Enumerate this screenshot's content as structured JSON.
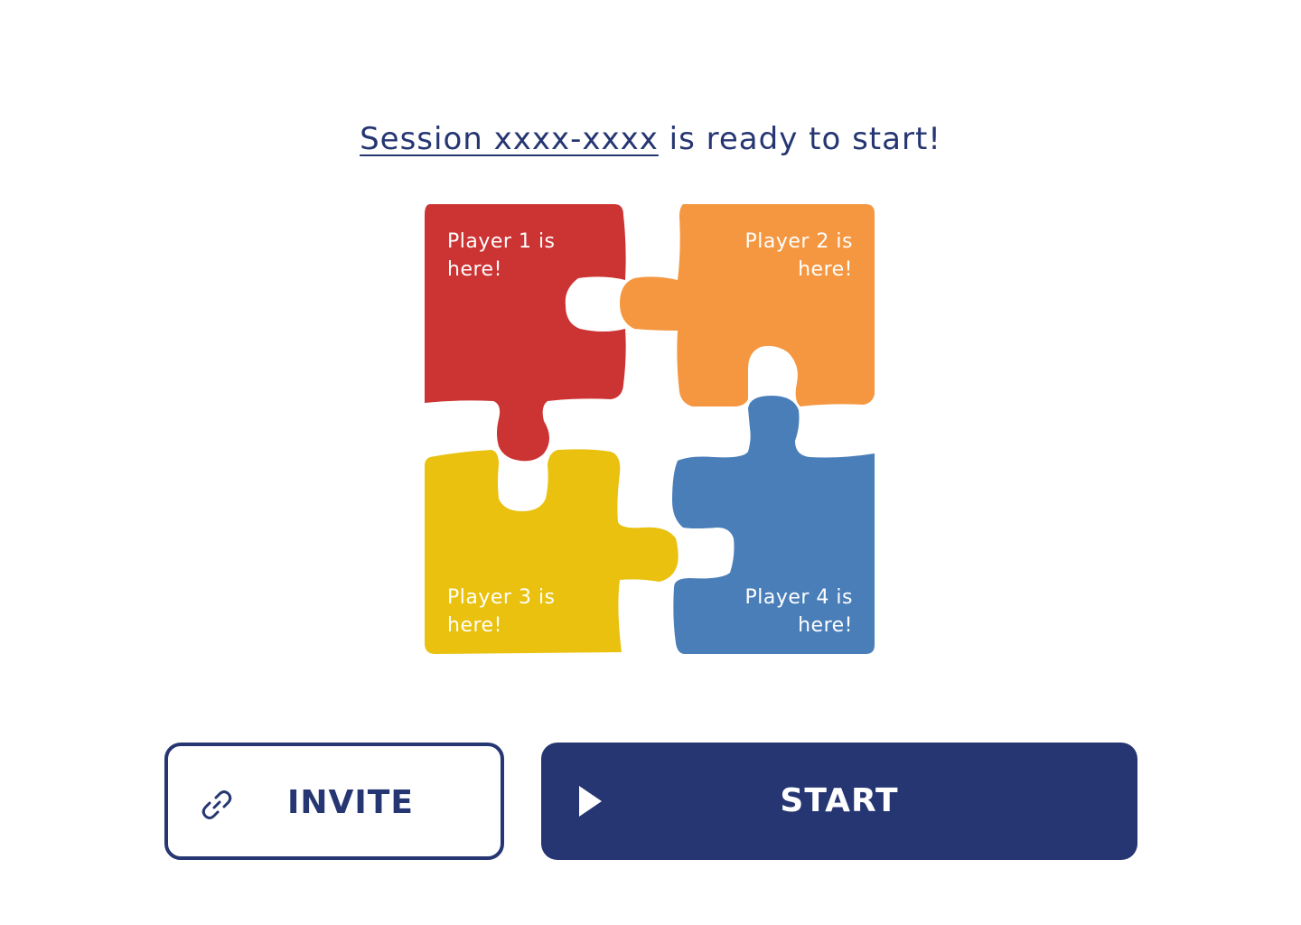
{
  "header": {
    "session_link_text": "Session xxxx-xxxx",
    "title_suffix": " is ready to start!"
  },
  "players": [
    {
      "label": "Player 1 is here!",
      "color": "#CC3333"
    },
    {
      "label": "Player 2 is here!",
      "color": "#F59740"
    },
    {
      "label": "Player 3 is here!",
      "color": "#E9C10E"
    },
    {
      "label": "Player 4 is here!",
      "color": "#4A7EB9"
    }
  ],
  "actions": {
    "invite_label": "INVITE",
    "invite_icon": "link-icon",
    "start_label": "START",
    "start_icon": "play-icon"
  },
  "colors": {
    "primary": "#253672",
    "background": "#FFFFFF"
  }
}
